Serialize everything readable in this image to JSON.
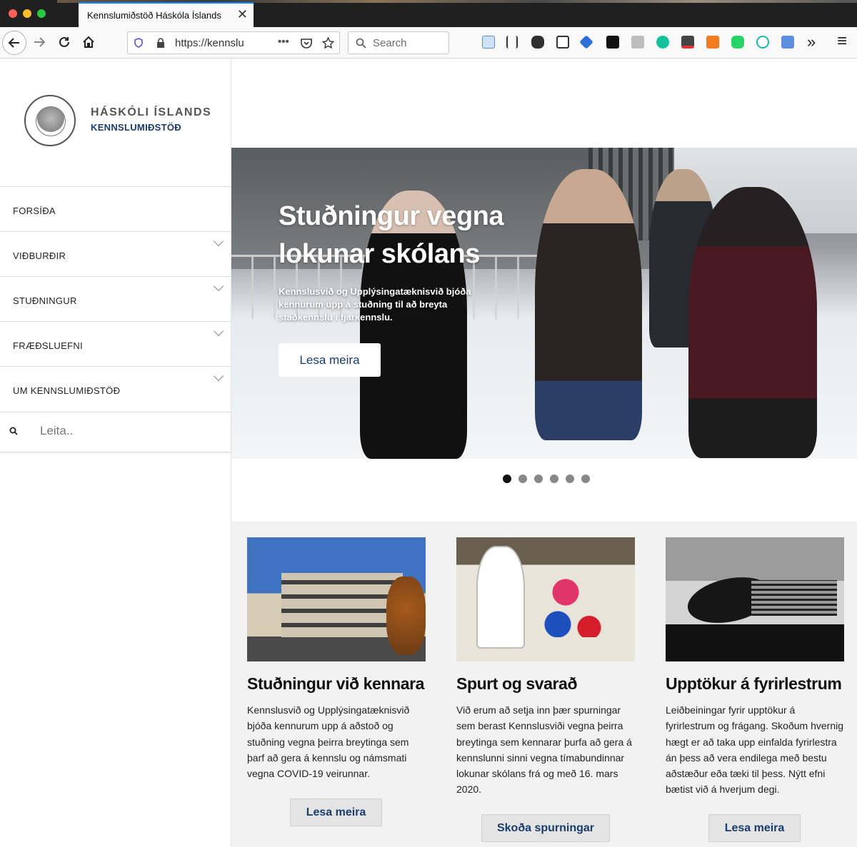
{
  "browser": {
    "tab_title": "Kennslumiðstöð Háskóla Íslands",
    "tab_close": "✕",
    "url": "https://kennslu",
    "url_more": "•••",
    "search_placeholder": "Search",
    "overflow": "»",
    "menu": "≡"
  },
  "sidebar": {
    "logo_line1": "HÁSKÓLI ÍSLANDS",
    "logo_line2": "KENNSLUMIÐSTÖÐ",
    "menu": [
      {
        "label": "FORSÍÐA"
      },
      {
        "label": "VIÐBURÐIR"
      },
      {
        "label": "STUÐNINGUR"
      },
      {
        "label": "FRÆÐSLUEFNI"
      },
      {
        "label": "UM KENNSLUMIÐSTÖÐ"
      }
    ],
    "search_placeholder": "Leita.."
  },
  "hero": {
    "title": "Stuðningur vegna lokunar skólans",
    "subtitle": "Kennslusvið og Upplýsingatæknisvið bjóða kennurum upp á stuðning til að breyta staðkennslu í fjarkennslu.",
    "button": "Lesa meira",
    "slides": 6,
    "active_slide": 1
  },
  "cards": [
    {
      "title": "Stuðningur við kennara",
      "text": "Kennslusvið og Upplýsingatæknisvið bjóða kennurum upp á aðstoð og stuðning vegna þeirra breytinga sem þarf að gera á kennslu og námsmati vegna COVID-19 veirunnar.",
      "button": "Lesa meira"
    },
    {
      "title": "Spurt og svarað",
      "text": "Við erum að setja inn þær spurningar sem berast Kennslusviði vegna þeirra breytinga sem kennarar þurfa að gera á kennslunni sinni vegna tímabundinnar lokunar skólans frá og með 16. mars 2020.",
      "button": "Skoða spurningar"
    },
    {
      "title": "Upptökur á fyrirlestrum",
      "text": "Leiðbeiningar fyrir upptökur á fyrirlestrum og frágang. Skoðum hvernig hægt er að taka upp einfalda fyrirlestra án þess að vera endilega með bestu aðstæður eða tæki til þess. Nýtt efni bætist við á hverjum degi.",
      "button": "Lesa meira"
    }
  ]
}
